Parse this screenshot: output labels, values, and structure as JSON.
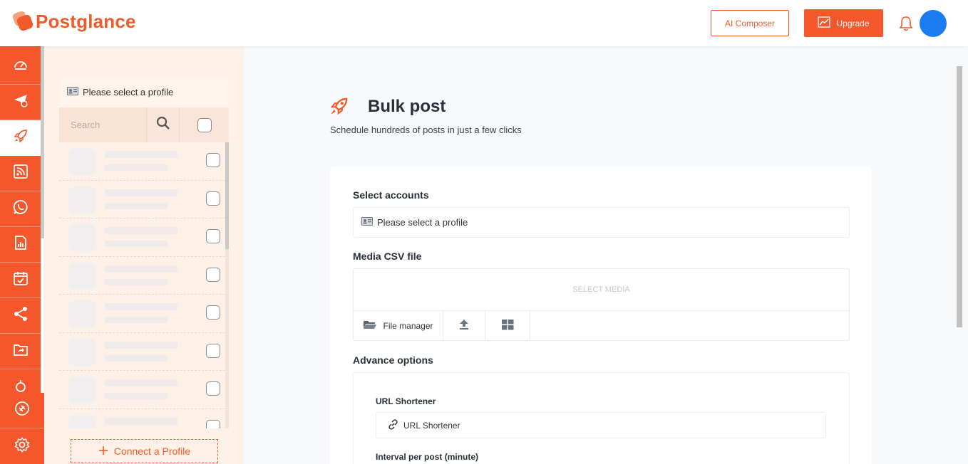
{
  "header": {
    "brand": "Postglance",
    "ai_composer_label": "AI Composer",
    "upgrade_label": "Upgrade"
  },
  "nav": {
    "items": [
      {
        "icon": "dashboard-icon"
      },
      {
        "icon": "send-icon"
      },
      {
        "icon": "rocket-icon",
        "active": true
      },
      {
        "icon": "rss-icon"
      },
      {
        "icon": "whatsapp-icon"
      },
      {
        "icon": "report-icon"
      },
      {
        "icon": "calendar-icon"
      },
      {
        "icon": "share-icon"
      },
      {
        "icon": "folder-share-icon"
      }
    ],
    "bottom": [
      {
        "icon": "plugin-icon"
      },
      {
        "icon": "settings-icon"
      }
    ]
  },
  "profiles": {
    "title": "Please select a profile",
    "search_placeholder": "Search",
    "connect_label": "Connect a Profile"
  },
  "page": {
    "title": "Bulk post",
    "subtitle": "Schedule hundreds of posts in just a few clicks"
  },
  "form": {
    "select_accounts_label": "Select accounts",
    "select_accounts_value": "Please select a profile",
    "media_label": "Media CSV file",
    "media_drop_text": "SELECT MEDIA",
    "file_manager_label": "File manager",
    "advance_label": "Advance options",
    "url_shortener_label": "URL Shortener",
    "url_shortener_value": "URL Shortener",
    "interval_label": "Interval per post (minute)"
  },
  "colors": {
    "accent": "#f4572c",
    "avatar": "#1a7cf0"
  }
}
